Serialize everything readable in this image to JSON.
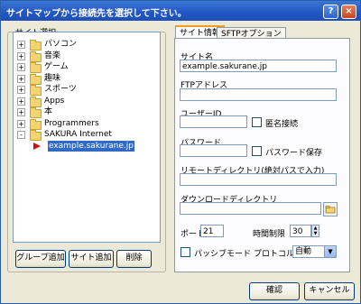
{
  "window": {
    "title": "サイトマップから接続先を選択して下さい。",
    "help_label": "?",
    "close_label": "×"
  },
  "left_group": {
    "label": "サイト選択",
    "tree": [
      {
        "label": "パソコン",
        "expander": "+"
      },
      {
        "label": "音楽",
        "expander": "+"
      },
      {
        "label": "ゲーム",
        "expander": "+"
      },
      {
        "label": "趣味",
        "expander": "+"
      },
      {
        "label": "スポーツ",
        "expander": "+"
      },
      {
        "label": "Apps",
        "expander": "+"
      },
      {
        "label": "本",
        "expander": "+"
      },
      {
        "label": "Programmers",
        "expander": "+"
      },
      {
        "label": "SAKURA Internet",
        "expander": "-"
      },
      {
        "label": "example.sakurane.jp",
        "expander": ""
      }
    ],
    "buttons": {
      "add_group": "グループ追加",
      "add_site": "サイト追加",
      "delete": "削除"
    }
  },
  "tabs": [
    {
      "label": "サイト情報",
      "active": true
    },
    {
      "label": "SFTPオプション",
      "active": false
    }
  ],
  "form": {
    "site_name_label": "サイト名",
    "site_name_value": "example.sakurane.jp",
    "ftp_address_label": "FTPアドレス",
    "ftp_address_value": "",
    "user_id_label": "ユーザーID",
    "user_id_value": "",
    "anonymous_label": "匿名接続",
    "password_label": "パスワード",
    "password_value": "",
    "save_password_label": "パスワード保存",
    "remote_dir_label": "リモートディレクトリ(絶対パスで入力)",
    "remote_dir_value": "",
    "download_dir_label": "ダウンロードディレクトリ",
    "download_dir_value": "",
    "port_label": "ポート",
    "port_value": "21",
    "timeout_label": "時間制限",
    "timeout_value": "30",
    "passive_label": "パッシブモード",
    "protocol_label": "プロトコル",
    "protocol_value": "自動"
  },
  "footer": {
    "ok_label": "確認",
    "cancel_label": "キャンセル"
  },
  "icons": {
    "folder": "folder-icon",
    "arrow": "selected-arrow-icon",
    "browse": "browse-folder-icon"
  }
}
